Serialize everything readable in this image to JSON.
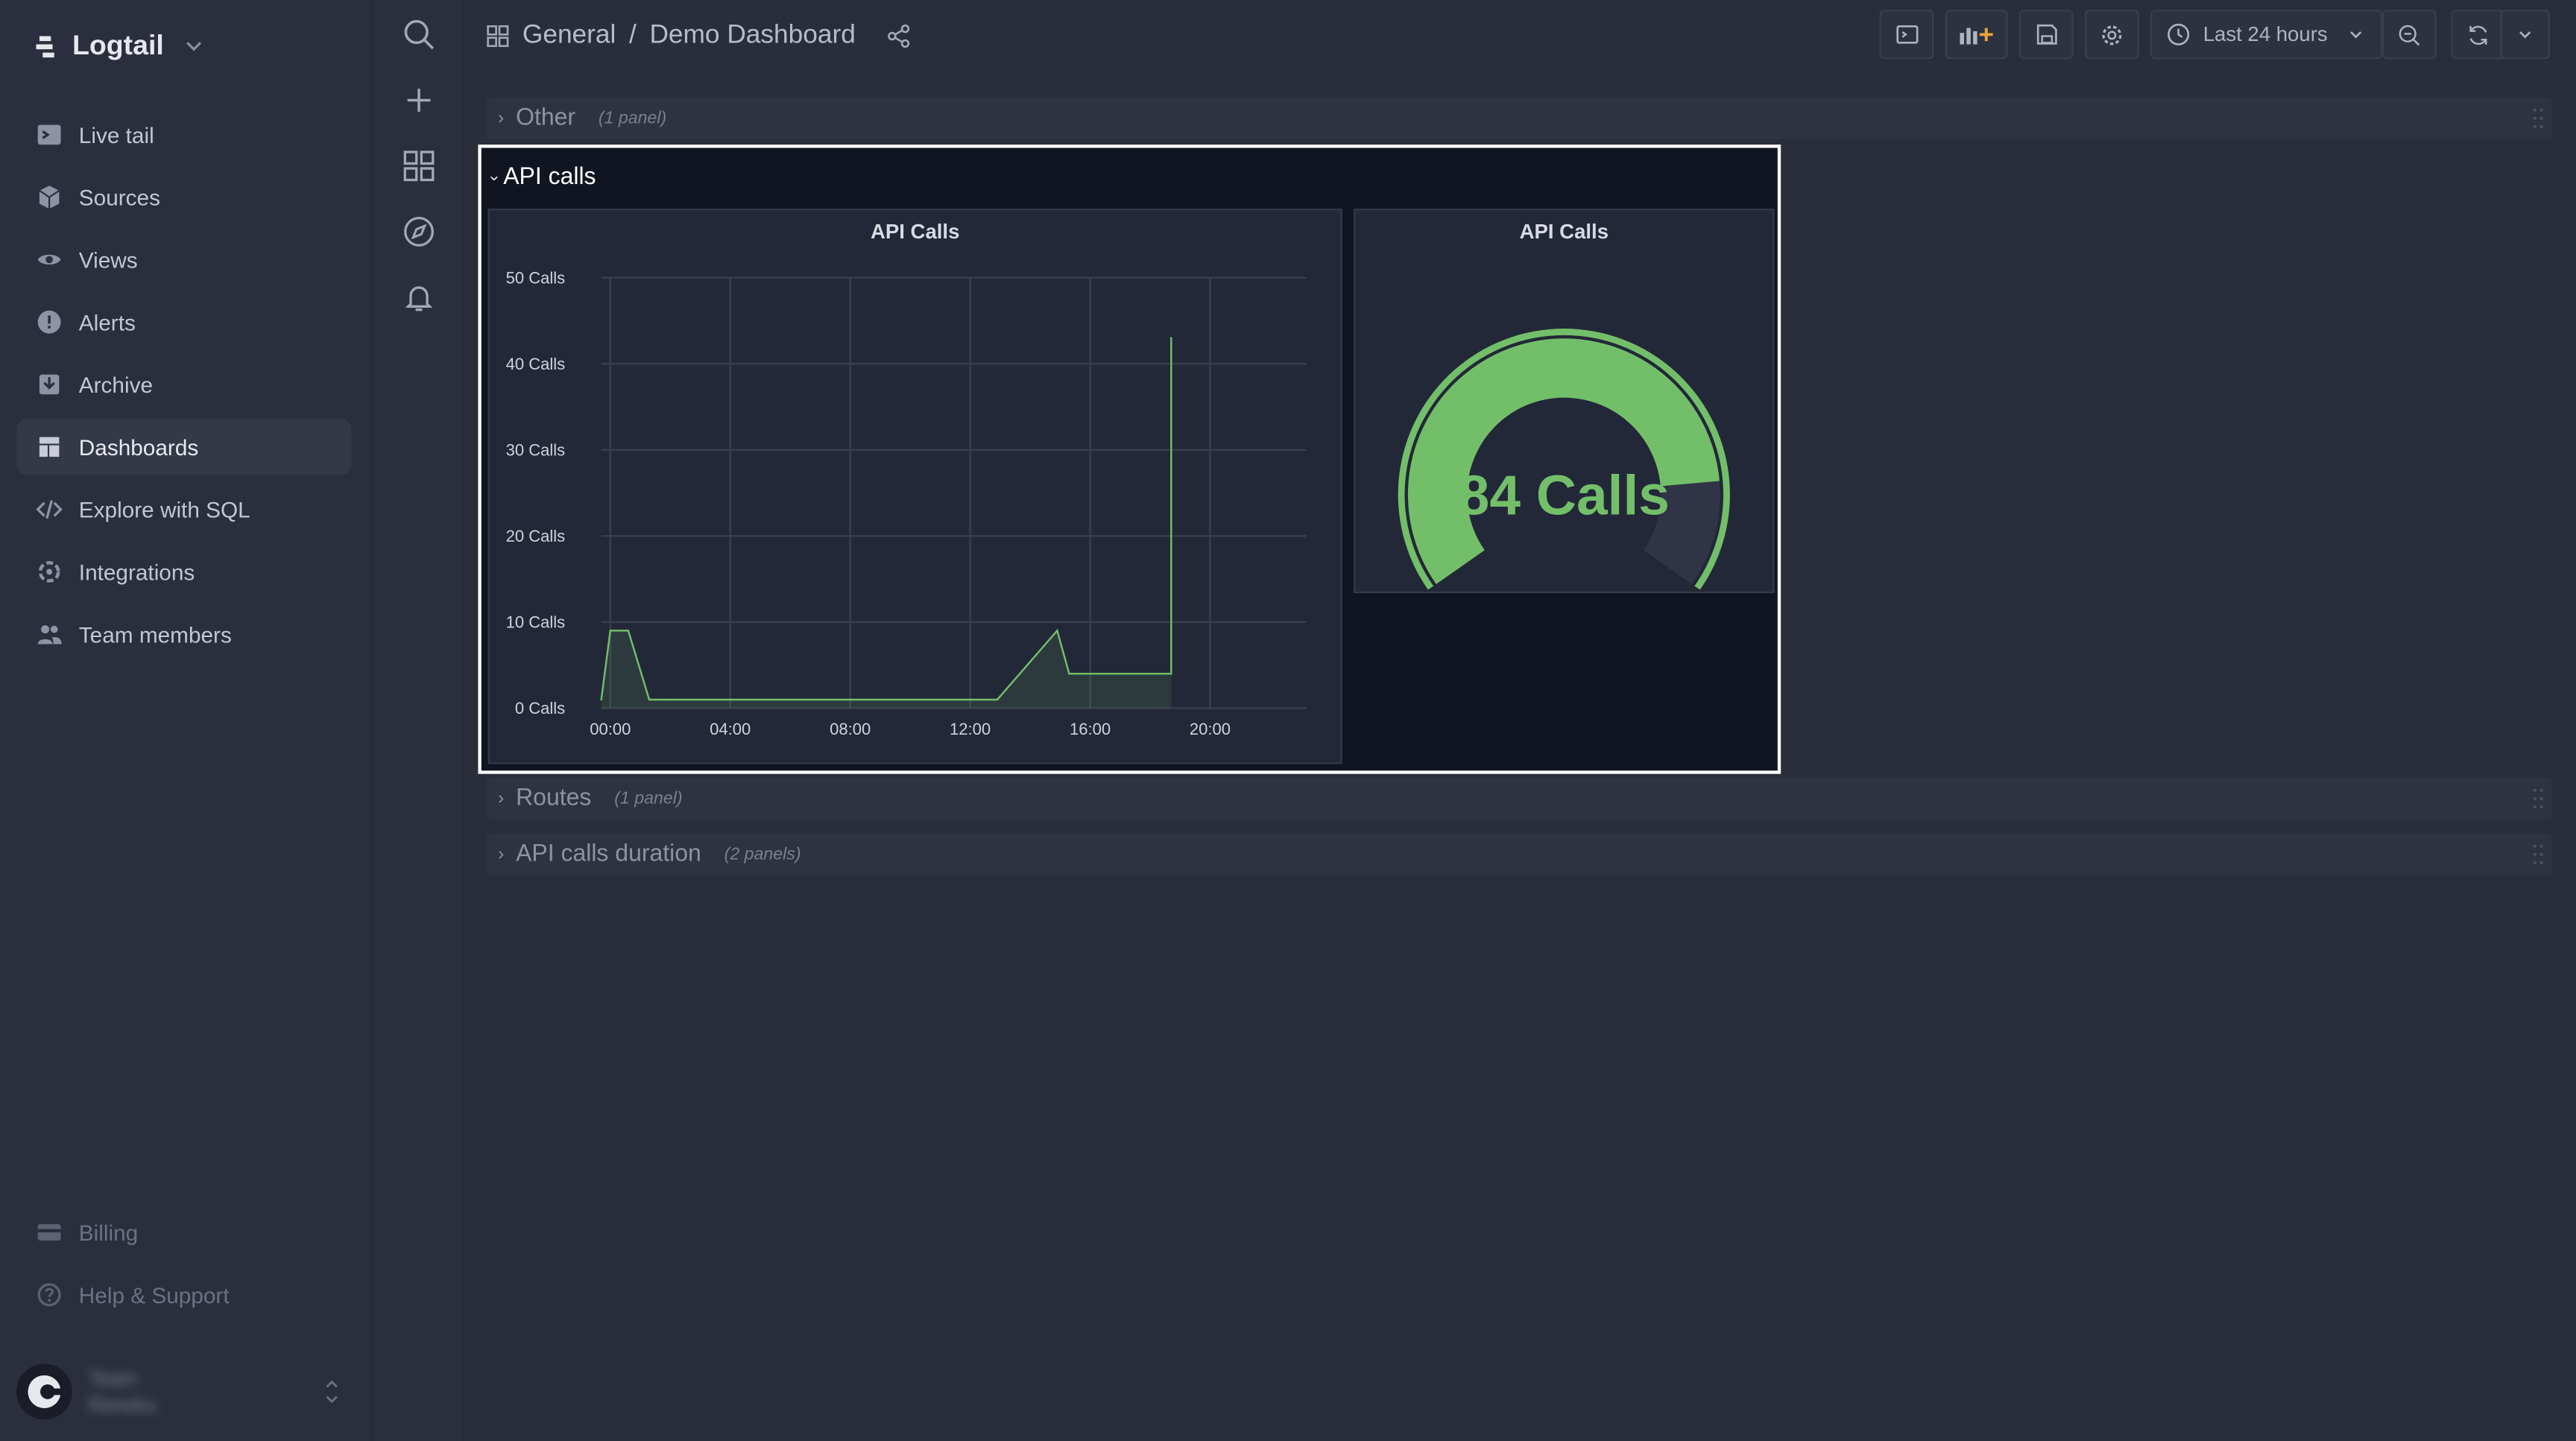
{
  "app": {
    "name": "Logtail",
    "accent": "#73bf69",
    "background": "#2b2f3d"
  },
  "sidebar": {
    "items": [
      {
        "label": "Live tail",
        "icon": "terminal-icon"
      },
      {
        "label": "Sources",
        "icon": "cube-icon"
      },
      {
        "label": "Views",
        "icon": "eye-icon"
      },
      {
        "label": "Alerts",
        "icon": "alert-icon"
      },
      {
        "label": "Archive",
        "icon": "archive-icon"
      },
      {
        "label": "Dashboards",
        "icon": "dashboard-icon",
        "active": true
      },
      {
        "label": "Explore with SQL",
        "icon": "code-icon"
      },
      {
        "label": "Integrations",
        "icon": "integrations-icon"
      },
      {
        "label": "Team members",
        "icon": "team-icon"
      }
    ],
    "footer_items": [
      {
        "label": "Billing",
        "icon": "billing-icon"
      },
      {
        "label": "Help & Support",
        "icon": "help-icon"
      }
    ],
    "user": {
      "team_label": "Team",
      "team_name": "Renoku"
    }
  },
  "rail": {
    "icons": [
      "search-icon",
      "plus-icon",
      "grid-icon",
      "compass-icon",
      "bell-icon"
    ]
  },
  "header": {
    "breadcrumb": [
      "General",
      "Demo Dashboard"
    ],
    "separator": "/",
    "time_range": "Last 24 hours"
  },
  "rows": [
    {
      "title": "Other",
      "panels": "(1 panel)",
      "collapsed": true
    },
    {
      "title": "API calls",
      "collapsed": false
    },
    {
      "title": "Routes",
      "panels": "(1 panel)",
      "collapsed": true
    },
    {
      "title": "API calls duration",
      "panels": "(2 panels)",
      "collapsed": true
    }
  ],
  "panels": {
    "timeseries": {
      "title": "API Calls"
    },
    "gauge": {
      "title": "API Calls",
      "value_text": "84 Calls"
    }
  },
  "chart_data": [
    {
      "type": "area",
      "title": "API Calls",
      "x_unit": "hour of day (24h window)",
      "xticks": [
        "00:00",
        "04:00",
        "08:00",
        "12:00",
        "16:00",
        "20:00"
      ],
      "yticks": [
        "0 Calls",
        "10 Calls",
        "20 Calls",
        "30 Calls",
        "40 Calls",
        "50 Calls"
      ],
      "ylim": [
        0,
        50
      ],
      "xlim": [
        -0.3,
        23.2
      ],
      "grid": true,
      "color": "#73bf69",
      "series": [
        {
          "x": [
            -0.3,
            0,
            0.6,
            1.3,
            2,
            4,
            8,
            12,
            12.9,
            14.9,
            15.3,
            16,
            18,
            18.7,
            18.7
          ],
          "y": [
            1,
            9,
            9,
            1,
            1,
            1,
            1,
            1,
            1,
            9,
            4,
            4,
            4,
            4,
            43
          ]
        }
      ]
    },
    {
      "type": "gauge",
      "title": "API Calls",
      "value": 84,
      "unit": "Calls",
      "min": 0,
      "max": 100,
      "thresholds": [
        {
          "value": 0,
          "color": "#73bf69"
        }
      ],
      "color": "#73bf69"
    }
  ]
}
